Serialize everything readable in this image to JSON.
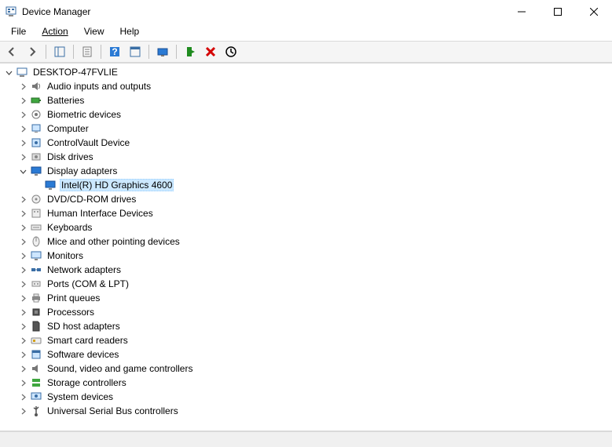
{
  "window": {
    "title": "Device Manager"
  },
  "menubar": {
    "file": "File",
    "action": "Action",
    "view": "View",
    "help": "Help"
  },
  "tree": {
    "root": {
      "label": "DESKTOP-47FVLIE",
      "expanded": true,
      "icon": "computer",
      "children": [
        {
          "label": "Audio inputs and outputs",
          "icon": "audio",
          "expanded": false
        },
        {
          "label": "Batteries",
          "icon": "battery",
          "expanded": false
        },
        {
          "label": "Biometric devices",
          "icon": "biometric",
          "expanded": false
        },
        {
          "label": "Computer",
          "icon": "pc",
          "expanded": false
        },
        {
          "label": "ControlVault Device",
          "icon": "vault",
          "expanded": false
        },
        {
          "label": "Disk drives",
          "icon": "disk",
          "expanded": false
        },
        {
          "label": "Display adapters",
          "icon": "display",
          "expanded": true,
          "children": [
            {
              "label": "Intel(R) HD Graphics 4600",
              "icon": "display",
              "selected": true
            }
          ]
        },
        {
          "label": "DVD/CD-ROM drives",
          "icon": "dvd",
          "expanded": false
        },
        {
          "label": "Human Interface Devices",
          "icon": "hid",
          "expanded": false
        },
        {
          "label": "Keyboards",
          "icon": "keyboard",
          "expanded": false
        },
        {
          "label": "Mice and other pointing devices",
          "icon": "mouse",
          "expanded": false
        },
        {
          "label": "Monitors",
          "icon": "monitor",
          "expanded": false
        },
        {
          "label": "Network adapters",
          "icon": "network",
          "expanded": false
        },
        {
          "label": "Ports (COM & LPT)",
          "icon": "port",
          "expanded": false
        },
        {
          "label": "Print queues",
          "icon": "printer",
          "expanded": false
        },
        {
          "label": "Processors",
          "icon": "cpu",
          "expanded": false
        },
        {
          "label": "SD host adapters",
          "icon": "sd",
          "expanded": false
        },
        {
          "label": "Smart card readers",
          "icon": "smartcard",
          "expanded": false
        },
        {
          "label": "Software devices",
          "icon": "software",
          "expanded": false
        },
        {
          "label": "Sound, video and game controllers",
          "icon": "sound",
          "expanded": false
        },
        {
          "label": "Storage controllers",
          "icon": "storage",
          "expanded": false
        },
        {
          "label": "System devices",
          "icon": "system",
          "expanded": false
        },
        {
          "label": "Universal Serial Bus controllers",
          "icon": "usb",
          "expanded": false
        }
      ]
    }
  }
}
